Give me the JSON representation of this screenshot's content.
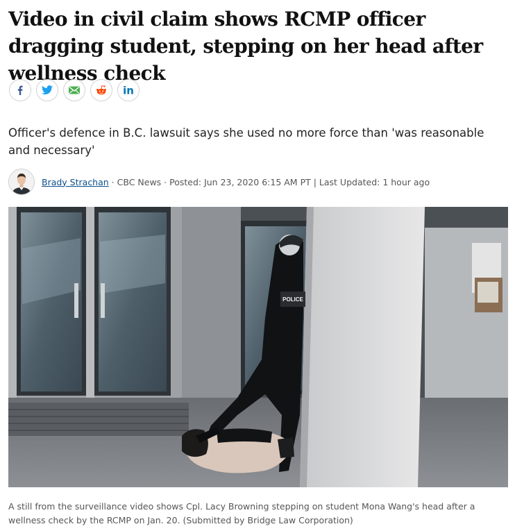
{
  "article": {
    "headline": "Video in civil claim shows RCMP officer dragging student, stepping on her head after wellness check",
    "dek": "Officer's defence in B.C. lawsuit says she used no more force than 'was reasonable and necessary'",
    "author": "Brady Strachan",
    "outlet": "CBC News",
    "posted": "Posted: Jun 23, 2020 6:15 AM PT",
    "updated": "Last Updated: 1 hour ago",
    "separator_dot": " · ",
    "separator_bar": " | "
  },
  "share": {
    "icons": [
      "facebook-icon",
      "twitter-icon",
      "email-icon",
      "reddit-icon",
      "linkedin-icon"
    ]
  },
  "photo": {
    "patch_text": "POLICE",
    "caption": "A still from the surveillance video shows Cpl. Lacy Browning stepping on student Mona Wang's head after a wellness check by the RCMP on Jan. 20. (Submitted by Bridge Law Corporation)"
  },
  "colors": {
    "facebook": "#3b5998",
    "twitter": "#1da1f2",
    "email": "#4caf50",
    "reddit": "#ff4500",
    "linkedin": "#0077b5",
    "author_link": "#0b4f8c"
  }
}
